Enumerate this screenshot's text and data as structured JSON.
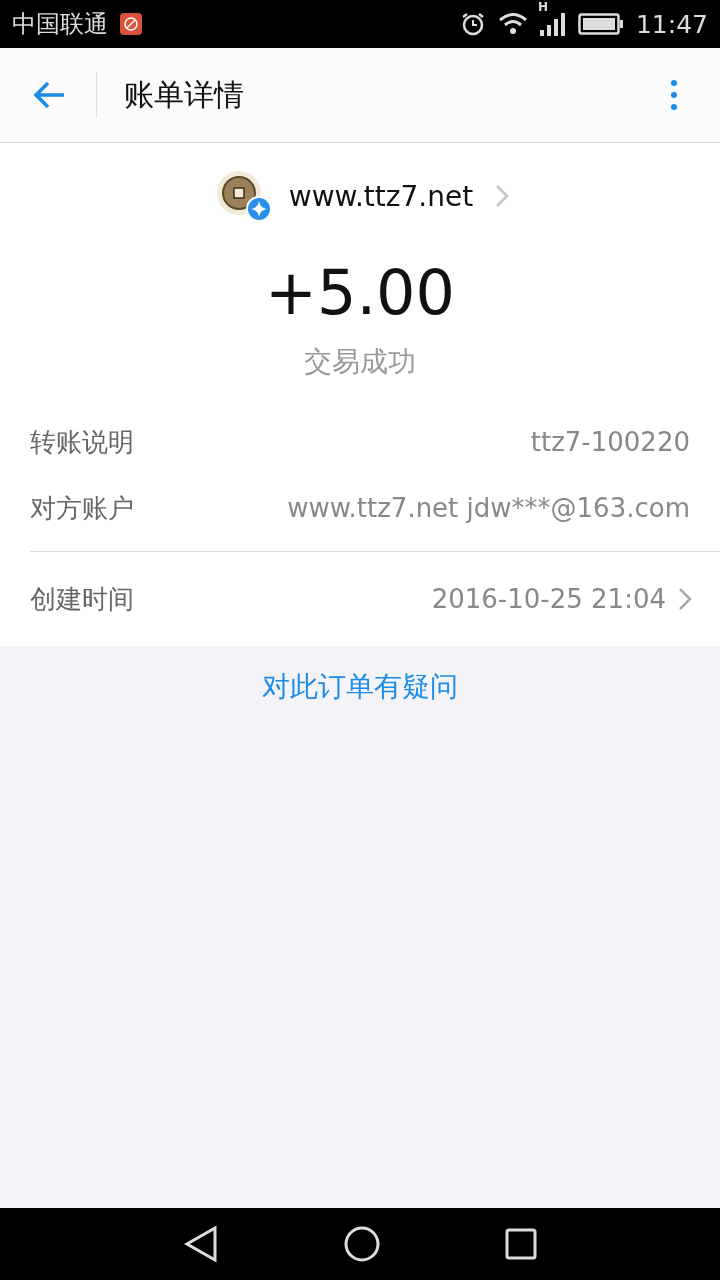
{
  "status_bar": {
    "carrier": "中国联通",
    "time": "11:47",
    "network": "H"
  },
  "header": {
    "title": "账单详情"
  },
  "merchant": {
    "name": "www.ttz7.net"
  },
  "amount": "+5.00",
  "status": "交易成功",
  "details": [
    {
      "label": "转账说明",
      "value": "ttz7-100220"
    },
    {
      "label": "对方账户",
      "value": "www.ttz7.net jdw***@163.com"
    }
  ],
  "created": {
    "label": "创建时间",
    "value": "2016-10-25 21:04"
  },
  "question_link": "对此订单有疑问"
}
